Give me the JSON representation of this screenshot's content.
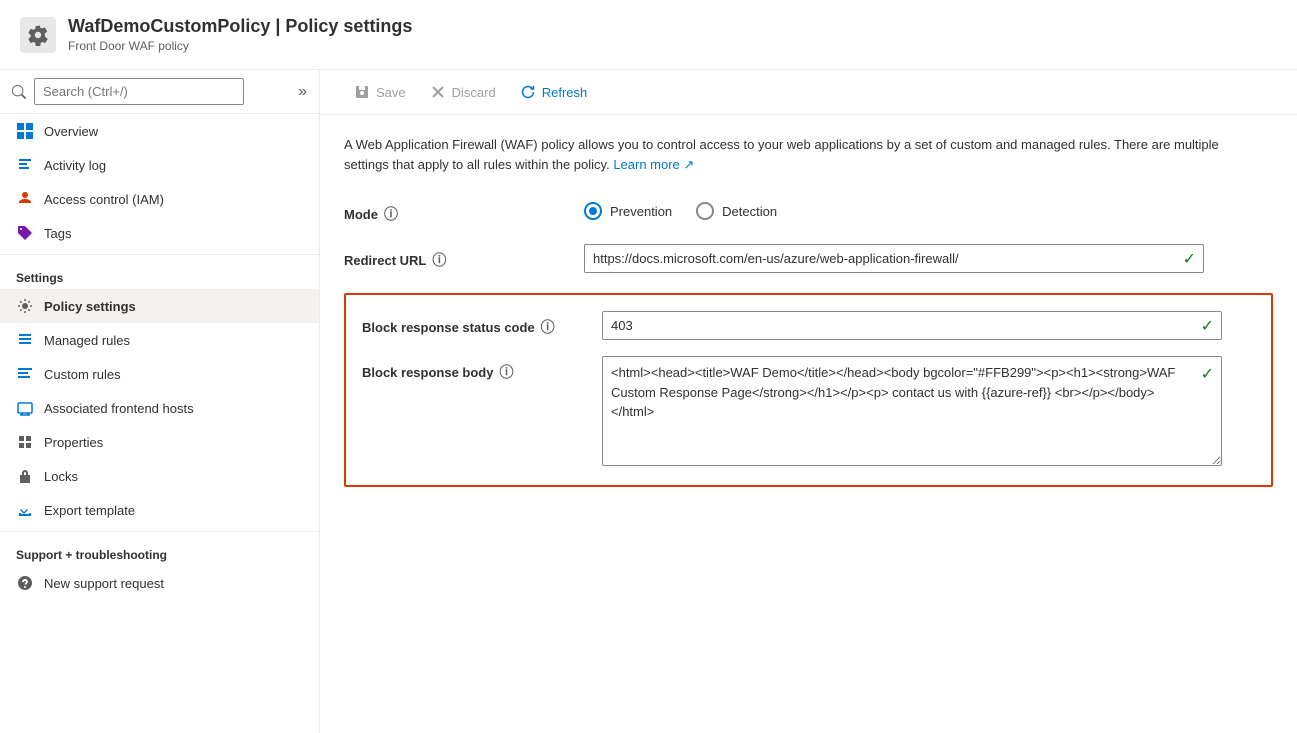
{
  "header": {
    "title": "WafDemoCustomPolicy | Policy settings",
    "subtitle": "Front Door WAF policy"
  },
  "search": {
    "placeholder": "Search (Ctrl+/)"
  },
  "toolbar": {
    "save_label": "Save",
    "discard_label": "Discard",
    "refresh_label": "Refresh"
  },
  "sidebar": {
    "items": [
      {
        "id": "overview",
        "label": "Overview",
        "icon": "grid"
      },
      {
        "id": "activity-log",
        "label": "Activity log",
        "icon": "list"
      },
      {
        "id": "access-control",
        "label": "Access control (IAM)",
        "icon": "person"
      },
      {
        "id": "tags",
        "label": "Tags",
        "icon": "tag"
      }
    ],
    "settings_section": "Settings",
    "settings_items": [
      {
        "id": "policy-settings",
        "label": "Policy settings",
        "icon": "settings",
        "active": true
      },
      {
        "id": "managed-rules",
        "label": "Managed rules",
        "icon": "rules"
      },
      {
        "id": "custom-rules",
        "label": "Custom rules",
        "icon": "custom-rules"
      },
      {
        "id": "associated-frontend-hosts",
        "label": "Associated frontend hosts",
        "icon": "hosts"
      },
      {
        "id": "properties",
        "label": "Properties",
        "icon": "properties"
      },
      {
        "id": "locks",
        "label": "Locks",
        "icon": "lock"
      },
      {
        "id": "export-template",
        "label": "Export template",
        "icon": "export"
      }
    ],
    "support_section": "Support + troubleshooting",
    "support_items": [
      {
        "id": "new-support-request",
        "label": "New support request",
        "icon": "person-support"
      }
    ]
  },
  "content": {
    "description": "A Web Application Firewall (WAF) policy allows you to control access to your web applications by a set of custom and managed rules. There are multiple settings that apply to all rules within the policy.",
    "learn_more": "Learn more",
    "mode_label": "Mode",
    "prevention_label": "Prevention",
    "detection_label": "Detection",
    "mode_selected": "prevention",
    "redirect_url_label": "Redirect URL",
    "redirect_url_value": "https://docs.microsoft.com/en-us/azure/web-application-firewall/",
    "block_response_status_code_label": "Block response status code",
    "block_response_status_code_value": "403",
    "block_response_body_label": "Block response body",
    "block_response_body_value": "<html><head><title>WAF Demo</title></head><body bgcolor=\"#FFB299\"><p><h1><strong>WAF Custom Response Page</strong></h1></p><p> contact us with {{azure-ref}} <br></p></body></html>"
  }
}
